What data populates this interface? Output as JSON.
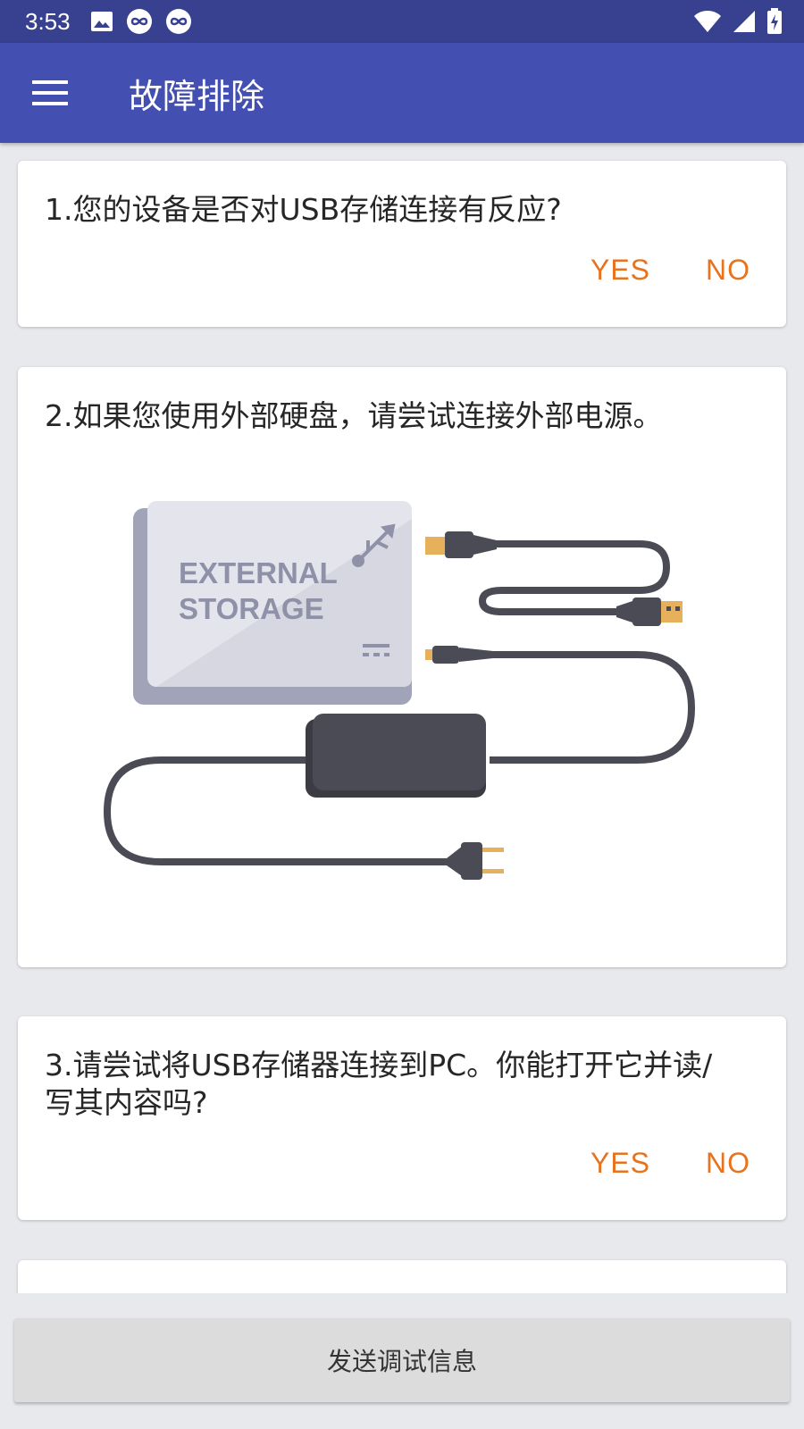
{
  "status_bar": {
    "time": "3:53",
    "icons_left": [
      "image-icon",
      "infinity-icon",
      "infinity-icon"
    ],
    "icons_right": [
      "wifi-icon",
      "signal-icon",
      "battery-charging-icon"
    ]
  },
  "app_bar": {
    "title": "故障排除",
    "menu_icon": "hamburger-menu-icon"
  },
  "cards": [
    {
      "question": "1.您的设备是否对USB存储连接有反应?",
      "yes_label": "YES",
      "no_label": "NO"
    },
    {
      "question": "2.如果您使用外部硬盘，请尝试连接外部电源。",
      "illustration": {
        "line1": "EXTERNAL",
        "line2": "STORAGE"
      }
    },
    {
      "question": "3.请尝试将USB存储器连接到PC。你能打开它并读/写其内容吗?",
      "yes_label": "YES",
      "no_label": "NO"
    }
  ],
  "bottom_button": {
    "label": "发送调试信息"
  },
  "colors": {
    "status_bar": "#374190",
    "app_bar": "#4450b1",
    "accent": "#e8731f",
    "background": "#e8e9ec"
  }
}
